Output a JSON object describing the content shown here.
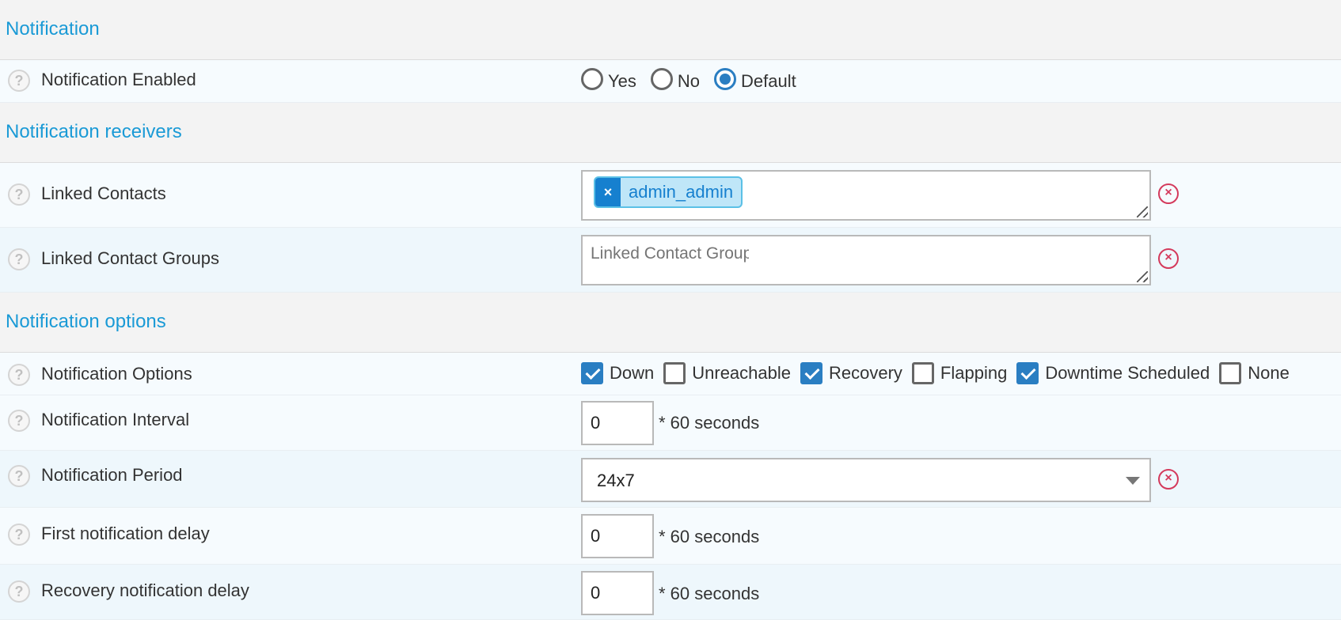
{
  "sections": {
    "notification": "Notification",
    "receivers": "Notification receivers",
    "options": "Notification options"
  },
  "notification_enabled": {
    "label": "Notification Enabled",
    "options": [
      "Yes",
      "No",
      "Default"
    ],
    "selected": "Default"
  },
  "linked_contacts": {
    "label": "Linked Contacts",
    "tags": [
      "admin_admin"
    ],
    "tag_remove_symbol": "×"
  },
  "linked_contact_groups": {
    "label": "Linked Contact Groups",
    "placeholder": "Linked Contact Groups"
  },
  "notification_options": {
    "label": "Notification Options",
    "items": [
      {
        "label": "Down",
        "checked": true
      },
      {
        "label": "Unreachable",
        "checked": false
      },
      {
        "label": "Recovery",
        "checked": true
      },
      {
        "label": "Flapping",
        "checked": false
      },
      {
        "label": "Downtime Scheduled",
        "checked": true
      },
      {
        "label": "None",
        "checked": false
      }
    ]
  },
  "notification_interval": {
    "label": "Notification Interval",
    "value": "0",
    "unit": "* 60 seconds"
  },
  "notification_period": {
    "label": "Notification Period",
    "value": "24x7"
  },
  "first_notification_delay": {
    "label": "First notification delay",
    "value": "0",
    "unit": "* 60 seconds"
  },
  "recovery_notification_delay": {
    "label": "Recovery notification delay",
    "value": "0",
    "unit": "* 60 seconds"
  },
  "icons": {
    "help": "?",
    "clear": "×"
  },
  "colors": {
    "accent": "#1a9ad6",
    "checked": "#2a7ec2",
    "clear": "#d43a5c",
    "tag_bg": "#bfe6f8"
  }
}
